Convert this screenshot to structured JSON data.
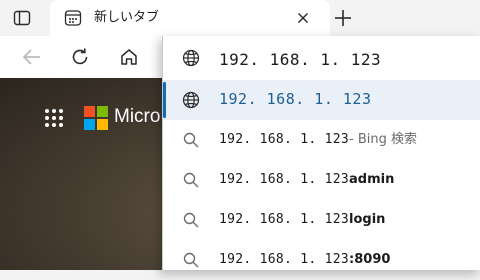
{
  "tab": {
    "title": "新しいタブ"
  },
  "page": {
    "brand_text": "Micro"
  },
  "omnibox": {
    "input_value": "192. 168. 1. 123",
    "suggestions": [
      {
        "type": "url",
        "text": "192. 168. 1. 123",
        "suffix": ""
      },
      {
        "type": "search",
        "text": "192. 168. 1. 123",
        "suffix": "- Bing 検索"
      },
      {
        "type": "search",
        "text": "192. 168. 1. 123",
        "suffix": "admin"
      },
      {
        "type": "search",
        "text": "192. 168. 1. 123",
        "suffix": "login"
      },
      {
        "type": "search",
        "text": "192. 168. 1. 123",
        "suffix": ":8090"
      }
    ]
  },
  "icons": {
    "tab_actions": "tab-actions-icon",
    "favicon": "new-tab-page-icon",
    "close": "close-icon",
    "new_tab": "plus-icon",
    "back": "back-arrow-icon",
    "refresh": "refresh-icon",
    "home": "home-icon",
    "globe": "globe-icon",
    "search": "search-icon",
    "apps": "app-launcher-icon",
    "logo": "microsoft-logo-icon"
  },
  "colors": {
    "accent": "#0f6cbd",
    "selected_row": "#eaf0f7",
    "url_text": "#1f5f94",
    "ms_red": "#f25022",
    "ms_green": "#7fba00",
    "ms_blue": "#00a4ef",
    "ms_yellow": "#ffb900"
  }
}
